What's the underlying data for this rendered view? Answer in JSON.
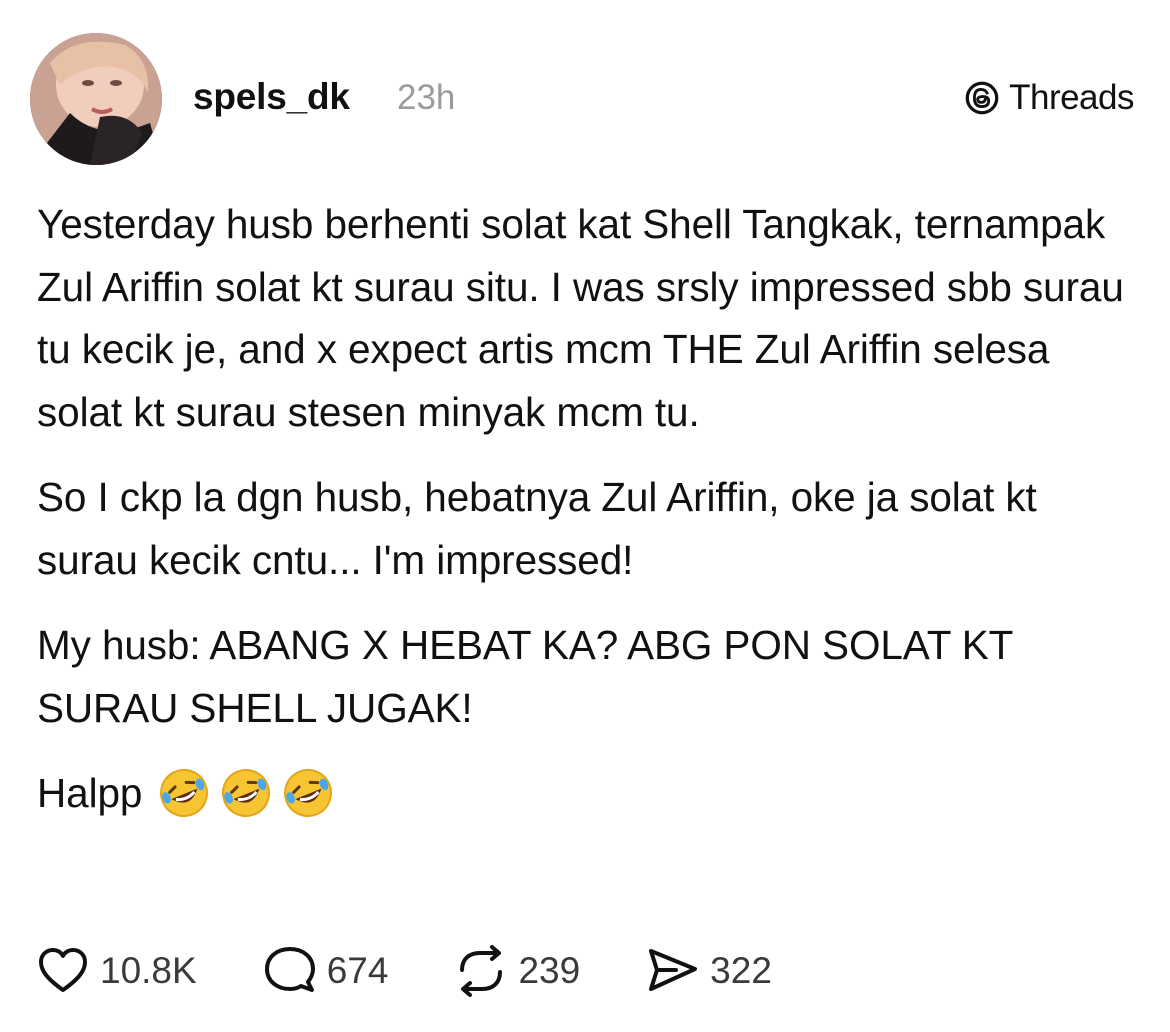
{
  "post": {
    "author": {
      "username": "spels_dk",
      "time": "23h"
    },
    "brand": {
      "label": "Threads",
      "icon": "threads-logo-icon"
    },
    "paragraphs": [
      "Yesterday husb berhenti solat kat Shell Tangkak, ternampak Zul Ariffin solat kt surau situ. I was srsly impressed sbb surau tu kecik je, and x expect artis mcm THE Zul Ariffin selesa solat kt surau stesen minyak mcm tu.",
      "So I ckp la dgn husb, hebatnya Zul Ariffin, oke ja solat kt surau kecik cntu... I'm impressed!",
      "My husb: ABANG X HEBAT KA? ABG PON SOLAT KT SURAU SHELL JUGAK!",
      "Halpp"
    ],
    "emojis": [
      "rolling-on-floor-laughing",
      "rolling-on-floor-laughing",
      "rolling-on-floor-laughing"
    ]
  },
  "actions": {
    "likes": {
      "icon": "heart-icon",
      "count": "10.8K"
    },
    "replies": {
      "icon": "comment-icon",
      "count": "674"
    },
    "reposts": {
      "icon": "repost-icon",
      "count": "239"
    },
    "shares": {
      "icon": "share-icon",
      "count": "322"
    }
  }
}
